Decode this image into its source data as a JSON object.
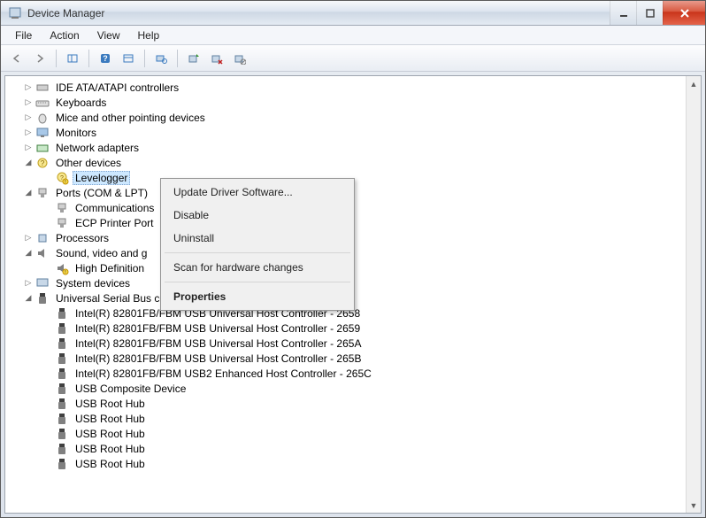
{
  "window": {
    "title": "Device Manager"
  },
  "menu": {
    "file": "File",
    "action": "Action",
    "view": "View",
    "help": "Help"
  },
  "tree": {
    "ide": "IDE ATA/ATAPI controllers",
    "keyboards": "Keyboards",
    "mice": "Mice and other pointing devices",
    "monitors": "Monitors",
    "network": "Network adapters",
    "other": "Other devices",
    "levelogger": "Levelogger",
    "ports": "Ports (COM & LPT)",
    "commport": "Communications",
    "ecp": "ECP Printer Port",
    "processors": "Processors",
    "sound": "Sound, video and g",
    "hdaudio": "High Definition",
    "system": "System devices",
    "usb": "Universal Serial Bus controllers",
    "usb_items": [
      "Intel(R) 82801FB/FBM USB Universal Host Controller - 2658",
      "Intel(R) 82801FB/FBM USB Universal Host Controller - 2659",
      "Intel(R) 82801FB/FBM USB Universal Host Controller - 265A",
      "Intel(R) 82801FB/FBM USB Universal Host Controller - 265B",
      "Intel(R) 82801FB/FBM USB2 Enhanced Host Controller - 265C",
      "USB Composite Device",
      "USB Root Hub",
      "USB Root Hub",
      "USB Root Hub",
      "USB Root Hub",
      "USB Root Hub"
    ]
  },
  "context": {
    "update": "Update Driver Software...",
    "disable": "Disable",
    "uninstall": "Uninstall",
    "scan": "Scan for hardware changes",
    "properties": "Properties"
  }
}
